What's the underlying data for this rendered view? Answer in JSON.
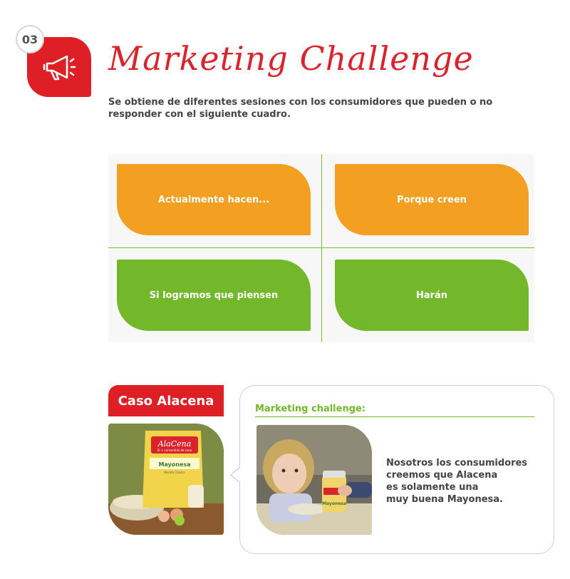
{
  "header": {
    "number": "03",
    "icon": "megaphone-icon",
    "title": "Marketing Challenge",
    "subtitle": "Se obtiene de diferentes sesiones con los consumidores que pueden o no responder con el siguiente cuadro."
  },
  "grid": {
    "cells": [
      {
        "label": "Actualmente hacen...",
        "color": "#f39f22"
      },
      {
        "label": "Porque creen",
        "color": "#f39f22"
      },
      {
        "label": "Si logramos que piensen",
        "color": "#72b82a"
      },
      {
        "label": "Harán",
        "color": "#72b82a"
      }
    ]
  },
  "case": {
    "tab_label": "Caso Alacena",
    "product": {
      "brand": "AlaCena",
      "tagline": "El + consentido de casa",
      "name": "Mayonesa",
      "variant": "Receta Clásica"
    }
  },
  "bubble": {
    "title": "Marketing challenge:",
    "jar_label": "Mayonesa",
    "text_lines": [
      "Nosotros los consumidores",
      "creemos que Alacena",
      "es solamente una",
      "muy buena Mayonesa."
    ]
  },
  "colors": {
    "red": "#df1f26",
    "orange": "#f39f22",
    "green": "#72b82a"
  }
}
